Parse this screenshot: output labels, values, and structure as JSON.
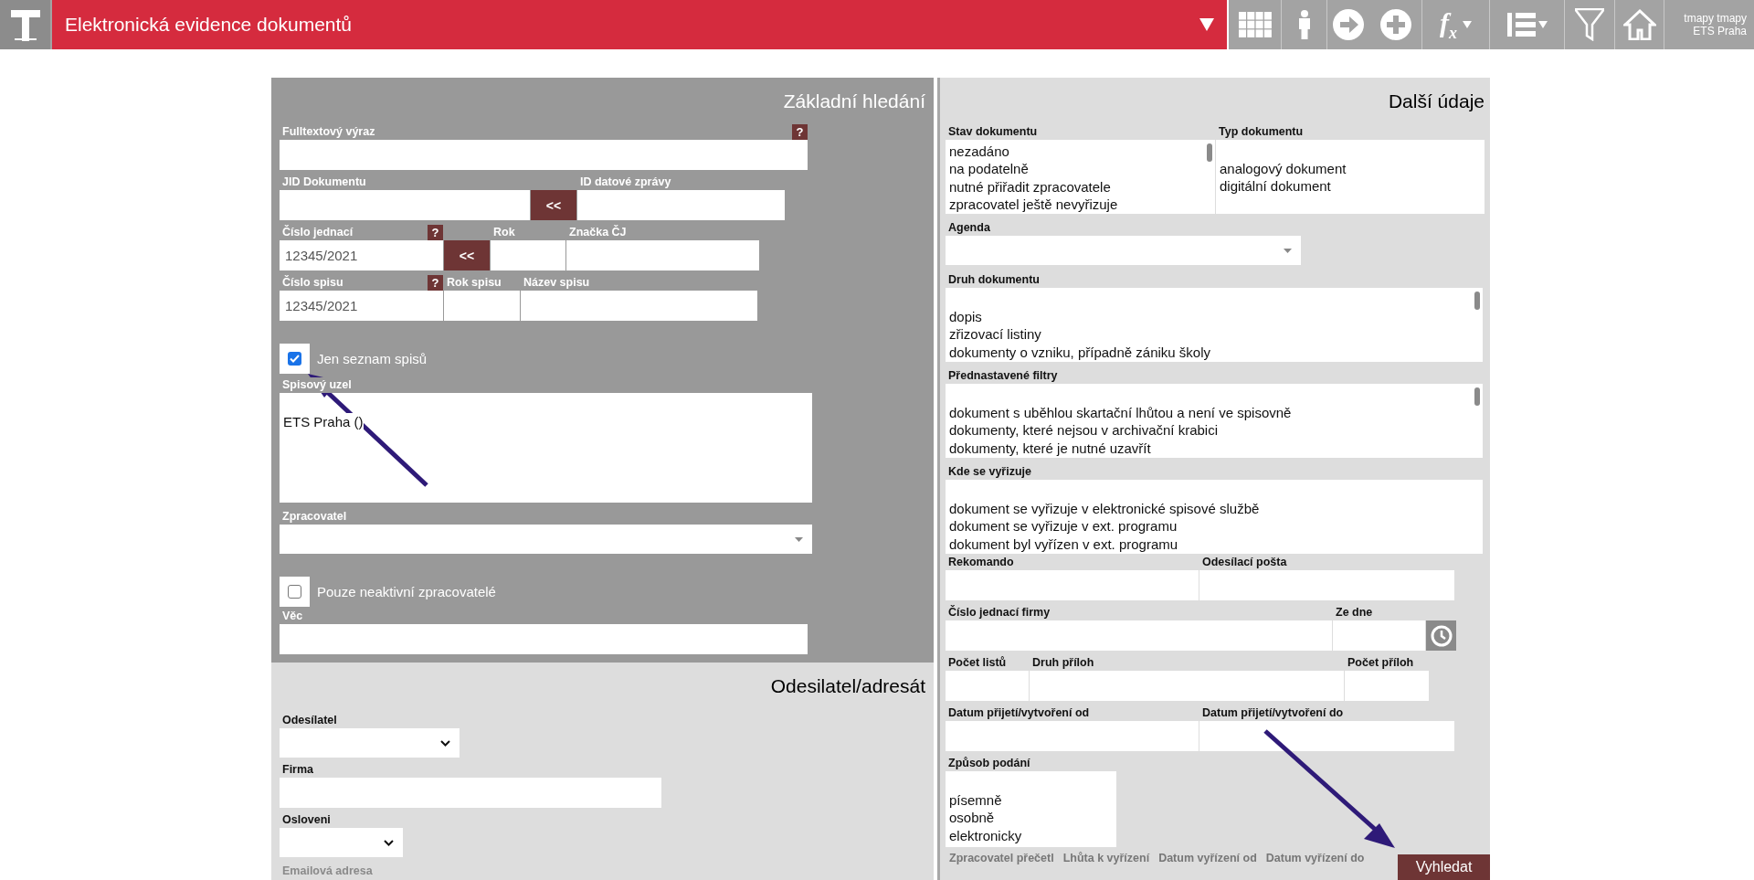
{
  "header": {
    "title": "Elektronická evidence dokumentů",
    "formula_label": "f$_{x}$",
    "user_name": "tmapy tmapy",
    "user_org": "ETS Praha"
  },
  "basic_search": {
    "title": "Základní hledání",
    "fulltext": {
      "label": "Fulltextový výraz",
      "help": "?"
    },
    "jid": {
      "label": "JID Dokumentu",
      "button": "<<"
    },
    "data_message_id": {
      "label": "ID datové zprávy"
    },
    "reference_number": {
      "label": "Číslo jednací",
      "help": "?",
      "value": "12345/2021",
      "button": "<<"
    },
    "year": {
      "label": "Rok"
    },
    "reference_mark": {
      "label": "Značka ČJ"
    },
    "file_number": {
      "label": "Číslo spisu",
      "help": "?",
      "value": "12345/2021"
    },
    "file_year": {
      "label": "Rok spisu"
    },
    "file_name": {
      "label": "Název spisu"
    },
    "only_files": {
      "label": "Jen seznam spisů",
      "checked": true
    },
    "file_node": {
      "label": "Spisový uzel",
      "blank_first": true,
      "options": [
        "ETS Praha ()"
      ]
    },
    "processor": {
      "label": "Zpracovatel"
    },
    "inactive_only": {
      "label": "Pouze neaktivní zpracovatelé",
      "checked": false
    },
    "subject": {
      "label": "Věc"
    }
  },
  "sender": {
    "title": "Odesilatel/adresát",
    "sender": {
      "label": "Odesílatel"
    },
    "company": {
      "label": "Firma"
    },
    "salutation": {
      "label": "Osloveni"
    },
    "email": {
      "label": "Emailová adresa"
    }
  },
  "more": {
    "title": "Další údaje",
    "doc_state": {
      "label": "Stav dokumentu",
      "blank_first": false,
      "options": [
        "nezadáno",
        "na podatelně",
        "nutné přiřadit zpracovatele",
        "zpracovatel ještě nevyřizuje"
      ]
    },
    "doc_type": {
      "label": "Typ dokumentu",
      "blank_first": true,
      "options": [
        "analogový dokument",
        "digitální dokument"
      ]
    },
    "agenda": {
      "label": "Agenda"
    },
    "doc_kind": {
      "label": "Druh dokumentu",
      "blank_first": true,
      "options": [
        "dopis",
        "zřizovací listiny",
        "dokumenty o vzniku, případně zániku školy"
      ]
    },
    "preset_filters": {
      "label": "Přednastavené filtry",
      "blank_first": true,
      "options": [
        "dokument s uběhlou skartační lhůtou a není ve spisovně",
        "dokumenty, které nejsou v archivační krabici",
        "dokumenty, které je nutné uzavřít"
      ]
    },
    "where_handled": {
      "label": "Kde se vyřizuje",
      "blank_first": true,
      "options": [
        "dokument se vyřizuje v elektronické spisové službě",
        "dokument se vyřizuje v ext. programu",
        "dokument byl vyřízen v ext. programu"
      ]
    },
    "registered": {
      "label": "Rekomando"
    },
    "post_office": {
      "label": "Odesílací pošta"
    },
    "company_ref": {
      "label": "Číslo jednací firmy"
    },
    "company_date": {
      "label": "Ze dne"
    },
    "sheet_count": {
      "label": "Počet listů"
    },
    "attachment_kind": {
      "label": "Druh příloh"
    },
    "attachment_count": {
      "label": "Počet příloh"
    },
    "received_from": {
      "label": "Datum přijetí/vytvoření od"
    },
    "received_to": {
      "label": "Datum přijetí/vytvoření do"
    },
    "submission": {
      "label": "Způsob podání",
      "blank_first": true,
      "options": [
        "písemně",
        "osobně",
        "elektronicky"
      ]
    },
    "footer_labels": [
      "Zpracovatel přečetl",
      "Lhůta k vyřízení",
      "Datum vyřízení od",
      "Datum vyřízení do"
    ]
  },
  "search_button": "Vyhledat"
}
